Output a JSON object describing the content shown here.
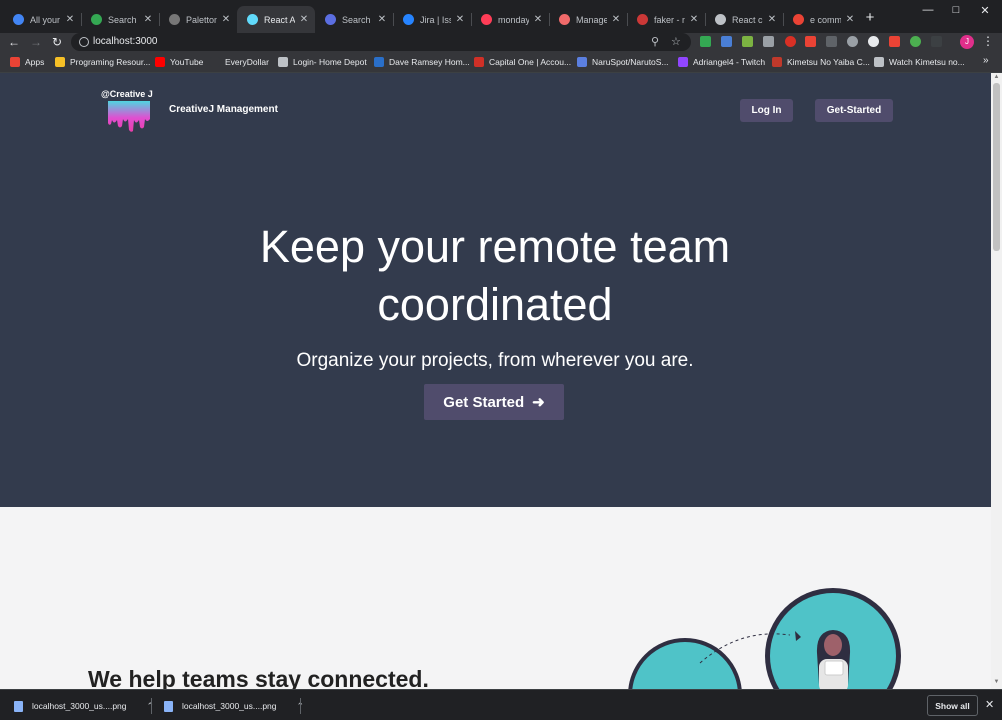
{
  "browser": {
    "tabs": [
      {
        "title": "All your d",
        "color": "#4285f4"
      },
      {
        "title": "Search - S",
        "color": "#34a853"
      },
      {
        "title": "Paletton",
        "color": "#777777"
      },
      {
        "title": "React App",
        "color": "#61dafb"
      },
      {
        "title": "Search | u",
        "color": "#5b6ee1"
      },
      {
        "title": "Jira | Issu",
        "color": "#2684ff"
      },
      {
        "title": "monday.c",
        "color": "#ff3d57"
      },
      {
        "title": "Manage y",
        "color": "#f06a6a"
      },
      {
        "title": "faker - np",
        "color": "#cb3837"
      },
      {
        "title": "React cre",
        "color": "#bdc1c6"
      },
      {
        "title": "e comme",
        "color": "#ea4335"
      }
    ],
    "active_tab": 3,
    "new_tab_label": "+",
    "url": "localhost:3000",
    "profile_initial": "J",
    "bookmarks": [
      {
        "label": "Apps",
        "color": "#ea4335"
      },
      {
        "label": "Programing Resour...",
        "color": "#f6c026"
      },
      {
        "label": "YouTube",
        "color": "#ff0000"
      },
      {
        "label": "EveryDollar",
        "color": "#35363a"
      },
      {
        "label": "Login- Home Depot",
        "color": "#bdc1c6"
      },
      {
        "label": "Dave Ramsey Hom...",
        "color": "#2a6fc9"
      },
      {
        "label": "Capital One | Accou...",
        "color": "#d03027"
      },
      {
        "label": "NaruSpot/NarutoS...",
        "color": "#5b7fe0"
      },
      {
        "label": "Adriangel4 - Twitch",
        "color": "#9146ff"
      },
      {
        "label": "Kimetsu No Yaiba C...",
        "color": "#c0392b"
      },
      {
        "label": "Watch Kimetsu no...",
        "color": "#bdc1c6"
      }
    ],
    "bookmarks_more": "»"
  },
  "header": {
    "logo_text": "@Creative J",
    "brand": "CreativeJ Management",
    "login_label": "Log In",
    "get_started_label": "Get-Started"
  },
  "hero": {
    "title_line1": "Keep your remote team",
    "title_line2": "coordinated",
    "subtitle": "Organize your projects, from wherever you are.",
    "cta_label": "Get Started"
  },
  "section": {
    "title": "We help teams stay connected."
  },
  "colors": {
    "hero_bg": "#333b4d",
    "button_bg": "#504c6c",
    "accent_teal": "#4fc3c8"
  },
  "downloads": {
    "items": [
      "localhost_3000_us....png",
      "localhost_3000_us....png"
    ],
    "show_all_label": "Show all"
  }
}
